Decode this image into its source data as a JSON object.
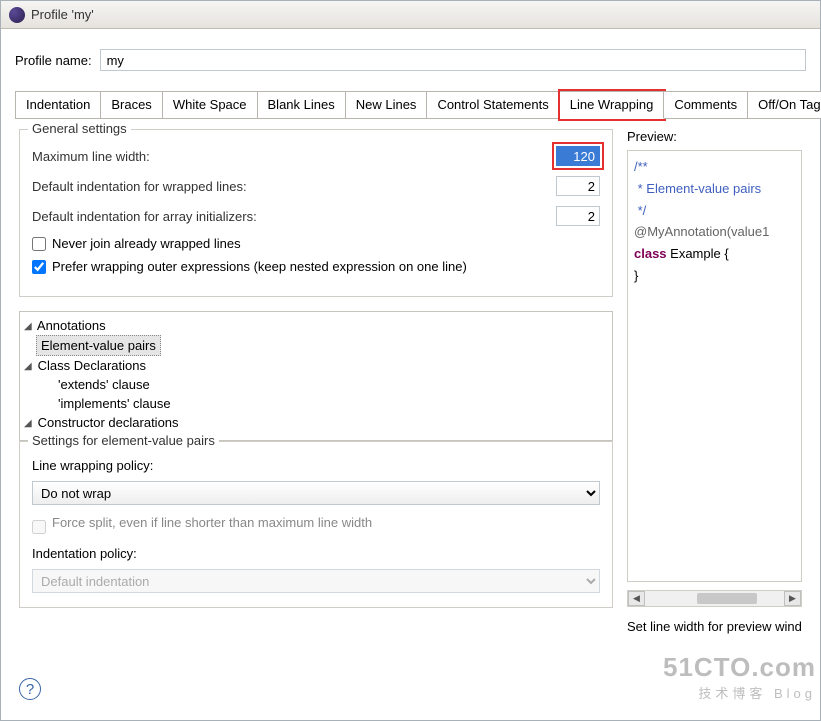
{
  "window": {
    "title": "Profile 'my'"
  },
  "profile": {
    "label": "Profile name:",
    "value": "my"
  },
  "tabs": [
    {
      "id": "indent",
      "label": "Indentation",
      "selected": false
    },
    {
      "id": "braces",
      "label": "Braces",
      "selected": false
    },
    {
      "id": "ws",
      "label": "White Space",
      "selected": false
    },
    {
      "id": "blank",
      "label": "Blank Lines",
      "selected": false
    },
    {
      "id": "newl",
      "label": "New Lines",
      "selected": false
    },
    {
      "id": "ctrl",
      "label": "Control Statements",
      "selected": false
    },
    {
      "id": "wrap",
      "label": "Line Wrapping",
      "selected": true
    },
    {
      "id": "comm",
      "label": "Comments",
      "selected": false
    },
    {
      "id": "ootags",
      "label": "Off/On Tags",
      "selected": false
    }
  ],
  "general": {
    "title": "General settings",
    "max_width_label": "Maximum line width:",
    "max_width_value": "120",
    "def_indent_wrapped_label": "Default indentation for wrapped lines:",
    "def_indent_wrapped_value": "2",
    "def_indent_array_label": "Default indentation for array initializers:",
    "def_indent_array_value": "2",
    "never_join_label": "Never join already wrapped lines",
    "never_join_checked": false,
    "prefer_outer_label": "Prefer wrapping outer expressions (keep nested expression on one line)",
    "prefer_outer_checked": true
  },
  "tree": [
    {
      "label": "Annotations",
      "expandable": true,
      "children": [
        {
          "label": "Element-value pairs",
          "selected": true
        }
      ]
    },
    {
      "label": "Class Declarations",
      "expandable": true,
      "children": [
        {
          "label": "'extends' clause"
        },
        {
          "label": "'implements' clause"
        }
      ]
    },
    {
      "label": "Constructor declarations",
      "expandable": true,
      "children": []
    }
  ],
  "settings_for": {
    "title": "Settings for element-value pairs",
    "policy_label": "Line wrapping policy:",
    "policy_value": "Do not wrap",
    "force_split_label": "Force split, even if line shorter than maximum line width",
    "force_split_checked": false,
    "force_split_enabled": false,
    "indent_policy_label": "Indentation policy:",
    "indent_policy_value": "Default indentation",
    "indent_policy_enabled": false
  },
  "preview": {
    "label": "Preview:",
    "code_comment": "/**\n * Element-value pairs\n */",
    "code_anno": "@MyAnnotation(value1",
    "code_kw": "class",
    "code_rest": " Example {",
    "code_close": "}",
    "hint": "Set line width for preview window"
  },
  "watermark": {
    "big": "51CTO.com",
    "small": "技术博客    Blog"
  }
}
